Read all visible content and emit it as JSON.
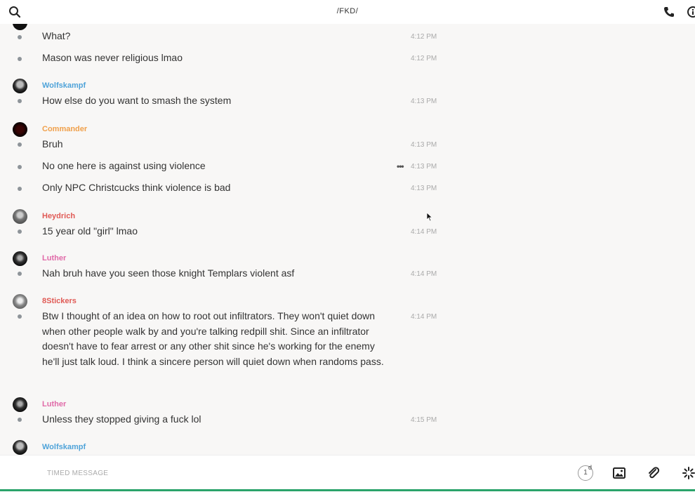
{
  "header": {
    "title": "/FKD/"
  },
  "messages": [
    {
      "text": "What?",
      "time": "4:12 PM"
    },
    {
      "text": "Mason was never religious lmao",
      "time": "4:12 PM"
    },
    {
      "author": "Wolfskampf",
      "author_color": "#4fa3d9",
      "text": "How else do you want to smash the system",
      "time": "4:13 PM"
    },
    {
      "author": "Commander",
      "author_color": "#f0a04b",
      "text": "Bruh",
      "time": "4:13 PM"
    },
    {
      "text": "No one here is against using violence",
      "time": "4:13 PM",
      "more_label": "•••"
    },
    {
      "text": "Only NPC Christcucks think violence is bad",
      "time": "4:13 PM"
    },
    {
      "author": "Heydrich",
      "author_color": "#e05a55",
      "text": "15 year old \"girl\" lmao",
      "time": "4:14 PM"
    },
    {
      "author": "Luther",
      "author_color": "#e06aa8",
      "text": "Nah bruh have you seen those knight Templars violent asf",
      "time": "4:14 PM"
    },
    {
      "author": "8Stickers",
      "author_color": "#e05a55",
      "text": "Btw I thought of an idea on how to root out infiltrators. They won't quiet down when other people walk by and you're talking redpill shit. Since an infiltrator doesn't have to fear arrest or any other shit since he's working for the enemy he'll just talk loud. I think a sincere person will quiet down when randoms pass.",
      "time": "4:14 PM"
    },
    {
      "author": "Luther",
      "author_color": "#e06aa8",
      "text": "Unless they stopped giving a fuck lol",
      "time": "4:15 PM"
    },
    {
      "author": "Wolfskampf",
      "author_color": "#4fa3d9"
    }
  ],
  "composer": {
    "placeholder": "TIMED MESSAGE",
    "timer_value": "1",
    "timer_unit": "d"
  },
  "icons": [
    "search-icon",
    "phone-icon",
    "info-icon",
    "image-icon",
    "paperclip-icon",
    "sparkle-icon"
  ],
  "colors": {
    "accent_green": "#2aa36a",
    "bullet": "#8e9499",
    "timestamp": "#aaaaaa"
  }
}
